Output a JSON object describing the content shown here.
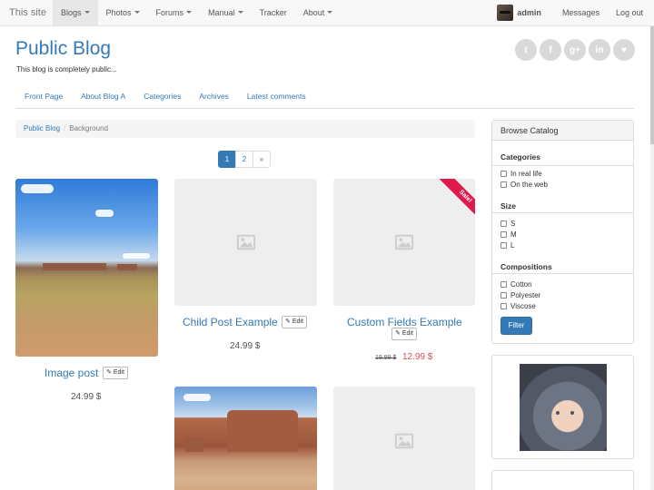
{
  "navbar": {
    "brand": "This site",
    "items": [
      {
        "label": "Blogs",
        "dropdown": true,
        "active": true
      },
      {
        "label": "Photos",
        "dropdown": true,
        "active": false
      },
      {
        "label": "Forums",
        "dropdown": true,
        "active": false
      },
      {
        "label": "Manual",
        "dropdown": true,
        "active": false
      },
      {
        "label": "Tracker",
        "dropdown": false,
        "active": false
      },
      {
        "label": "About",
        "dropdown": true,
        "active": false
      }
    ],
    "user": "admin",
    "messages": "Messages",
    "logout": "Log out"
  },
  "header": {
    "title": "Public Blog",
    "subtitle": "This blog is completely public...",
    "social_icons": [
      "twitter-icon",
      "facebook-icon",
      "google-plus-icon",
      "linkedin-icon",
      "github-icon"
    ],
    "social_glyphs": [
      "t",
      "f",
      "g+",
      "in",
      "♥"
    ]
  },
  "subnav": [
    "Front Page",
    "About Blog A",
    "Categories",
    "Archives",
    "Latest comments"
  ],
  "breadcrumb": {
    "link": "Public Blog",
    "sep": "/",
    "current": "Background"
  },
  "pagination": [
    "1",
    "2",
    "»"
  ],
  "products": [
    {
      "title": "Image post",
      "edit": "Edit",
      "price": "24.99 $"
    },
    {
      "title": "Child Post Example",
      "edit": "Edit",
      "price": "24.99 $"
    },
    {
      "title": "Custom Fields Example",
      "edit": "Edit",
      "old_price": "19.99 $",
      "sale_price": "12.99 $",
      "ribbon": "Sale!"
    }
  ],
  "sidebar": {
    "catalog_title": "Browse Catalog",
    "categories_title": "Categories",
    "categories": [
      "In real life",
      "On the web"
    ],
    "size_title": "Size",
    "sizes": [
      "S",
      "M",
      "L"
    ],
    "compositions_title": "Compositions",
    "compositions": [
      "Cotton",
      "Polyester",
      "Viscose"
    ],
    "filter_label": "Filter"
  },
  "colors": {
    "link": "#337ab7",
    "sale": "#d9534f",
    "ribbon": "#e0194c"
  }
}
